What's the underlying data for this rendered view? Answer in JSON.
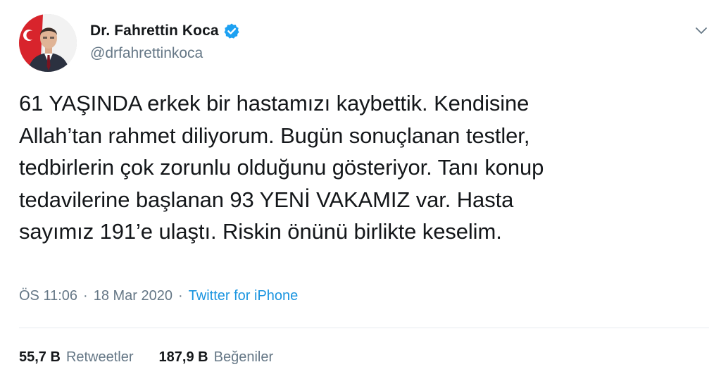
{
  "author": {
    "display_name": "Dr. Fahrettin Koca",
    "handle": "@drfahrettinkoca",
    "avatar_icon": "avatar-photo",
    "verified_icon": "verified-badge-icon"
  },
  "menu": {
    "caret_icon": "chevron-down-icon"
  },
  "tweet": {
    "text": "61 YAŞINDA erkek bir hastamızı kaybettik. Kendisine\nAllah’tan rahmet diliyorum. Bugün sonuçlanan testler,\ntedbirlerin çok zorunlu olduğunu gösteriyor. Tanı konup\ntedavilerine başlanan 93 YENİ VAKAMIZ var. Hasta\nsayımız 191’e ulaştı. Riskin önünü birlikte keselim."
  },
  "meta": {
    "time": "ÖS 11:06",
    "separator": "·",
    "date": "18 Mar 2020",
    "source": "Twitter for iPhone"
  },
  "stats": {
    "retweets_count": "55,7 B",
    "retweets_label": "Retweetler",
    "likes_count": "187,9 B",
    "likes_label": "Beğeniler"
  },
  "colors": {
    "text_primary": "#14171a",
    "text_secondary": "#657786",
    "link": "#1b95e0",
    "verified": "#1da1f2",
    "divider": "#e6ecf0"
  }
}
